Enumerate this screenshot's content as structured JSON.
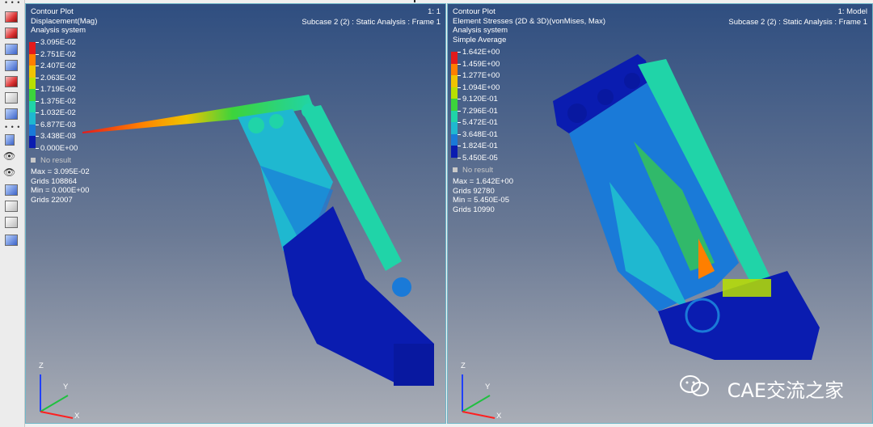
{
  "viewport1": {
    "title": "Contour Plot",
    "subtitle": "Displacement(Mag)",
    "system": "Analysis system",
    "frame_label": "1: 1",
    "subcase": "Subcase 2 (2) : Static Analysis : Frame 1",
    "legend_values": [
      "3.095E-02",
      "2.751E-02",
      "2.407E-02",
      "2.063E-02",
      "1.719E-02",
      "1.375E-02",
      "1.032E-02",
      "6.877E-03",
      "3.438E-03",
      "0.000E+00"
    ],
    "legend_colors": [
      "#e31a1c",
      "#ff7f00",
      "#f0c400",
      "#b8e000",
      "#3cd43c",
      "#20d4a8",
      "#1fb8d0",
      "#1a7ad8",
      "#0a1cb0"
    ],
    "no_result": "No result",
    "max": "Max = 3.095E-02",
    "grids_max": "Grids 108864",
    "min": "Min = 0.000E+00",
    "grids_min": "Grids 22007"
  },
  "viewport2": {
    "title": "Contour Plot",
    "subtitle": "Element Stresses (2D & 3D)(vonMises, Max)",
    "system": "Analysis system",
    "average": "Simple Average",
    "frame_label": "1: Model",
    "subcase": "Subcase 2 (2) : Static Analysis : Frame 1",
    "legend_values": [
      "1.642E+00",
      "1.459E+00",
      "1.277E+00",
      "1.094E+00",
      "9.120E-01",
      "7.296E-01",
      "5.472E-01",
      "3.648E-01",
      "1.824E-01",
      "5.450E-05"
    ],
    "legend_colors": [
      "#e31a1c",
      "#ff7f00",
      "#f0c400",
      "#b8e000",
      "#3cd43c",
      "#20d4a8",
      "#1fb8d0",
      "#1a7ad8",
      "#0a1cb0"
    ],
    "no_result": "No result",
    "max": "Max = 1.642E+00",
    "grids_max": "Grids 92780",
    "min": "Min = 5.450E-05",
    "grids_min": "Grids 10990"
  },
  "axes": {
    "z": "Z",
    "y": "Y",
    "x": "X"
  },
  "watermark": "CAE交流之家",
  "toolbar": {
    "icons": [
      "contour-icon",
      "deformed-icon",
      "vector-icon",
      "tensor-icon",
      "iso-icon",
      "measure-icon",
      "monitor-icon",
      "results-icon",
      "show-icon",
      "hide-icon",
      "isolate-icon",
      "reverse-icon",
      "visibility-icon",
      "entity-icon"
    ]
  }
}
